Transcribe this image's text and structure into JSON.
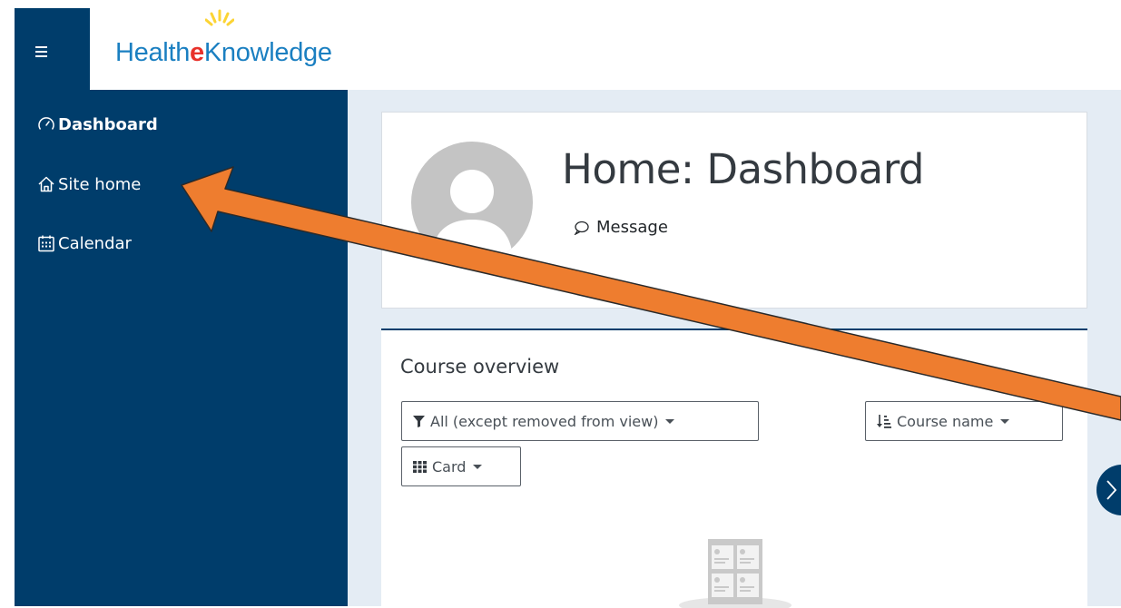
{
  "branding": {
    "logo_text_before": "Health",
    "logo_text_e": "e",
    "logo_text_after": "Knowledge",
    "brand_color": "#003d6b",
    "logo_blue": "#1a7fc1",
    "logo_red": "#e8312a",
    "logo_yellow": "#fcd434"
  },
  "sidebar": {
    "items": [
      {
        "label": "Dashboard",
        "icon": "dashboard-gauge-icon"
      },
      {
        "label": "Site home",
        "icon": "home-icon"
      },
      {
        "label": "Calendar",
        "icon": "calendar-icon"
      }
    ]
  },
  "header": {
    "title": "Home: Dashboard",
    "message_label": "Message"
  },
  "course_overview": {
    "title": "Course overview",
    "filter_label": "All (except removed from view)",
    "sort_label": "Course name",
    "view_label": "Card"
  },
  "colors": {
    "main_bg": "#e4ecf4",
    "annotation_arrow": "#ee7d2f"
  }
}
